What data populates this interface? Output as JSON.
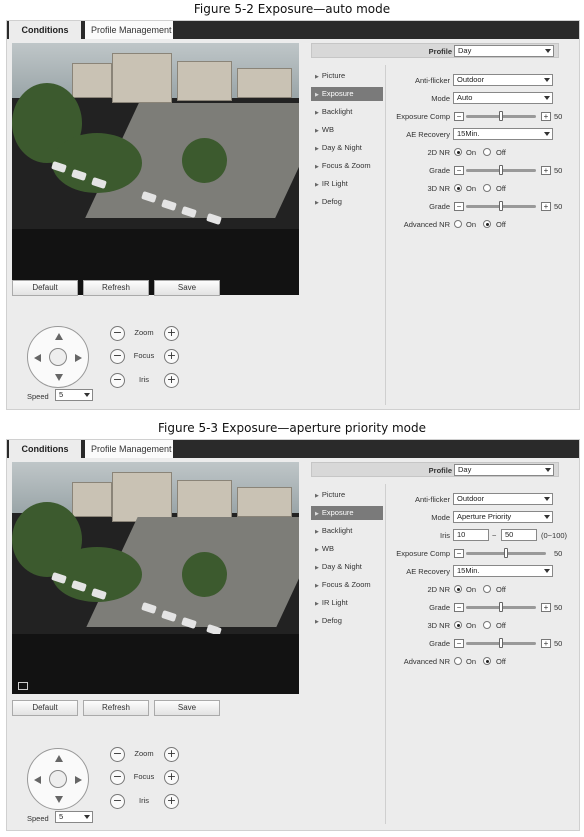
{
  "figures": [
    {
      "caption": "Figure 5-2 Exposure—auto mode",
      "tabs": [
        "Conditions",
        "Profile Management"
      ],
      "buttons": [
        "Default",
        "Refresh",
        "Save"
      ],
      "ptz": {
        "zoom": "Zoom",
        "focus": "Focus",
        "iris": "Iris",
        "speed_label": "Speed",
        "speed_value": "5",
        "minus": "−",
        "plus": "+"
      },
      "profile": {
        "label": "Profile",
        "value": "Day"
      },
      "menu": [
        "Picture",
        "Exposure",
        "Backlight",
        "WB",
        "Day & Night",
        "Focus & Zoom",
        "IR Light",
        "Defog"
      ],
      "active_menu": "Exposure",
      "fields": {
        "anti_flicker": {
          "label": "Anti-flicker",
          "value": "Outdoor"
        },
        "mode": {
          "label": "Mode",
          "value": "Auto"
        },
        "exposure_comp": {
          "label": "Exposure Comp",
          "value": "50"
        },
        "ae_recovery": {
          "label": "AE Recovery",
          "value": "15Min."
        },
        "nr2d": {
          "label": "2D NR",
          "on": "On",
          "off": "Off",
          "selected": "On"
        },
        "grade1": {
          "label": "Grade",
          "value": "50"
        },
        "nr3d": {
          "label": "3D NR",
          "on": "On",
          "off": "Off",
          "selected": "On"
        },
        "grade2": {
          "label": "Grade",
          "value": "50"
        },
        "advanced_nr": {
          "label": "Advanced NR",
          "on": "On",
          "off": "Off",
          "selected": "Off"
        }
      }
    },
    {
      "caption": "Figure 5-3 Exposure—aperture priority mode",
      "tabs": [
        "Conditions",
        "Profile Management"
      ],
      "buttons": [
        "Default",
        "Refresh",
        "Save"
      ],
      "ptz": {
        "zoom": "Zoom",
        "focus": "Focus",
        "iris": "Iris",
        "speed_label": "Speed",
        "speed_value": "5",
        "minus": "−",
        "plus": "+"
      },
      "profile": {
        "label": "Profile",
        "value": "Day"
      },
      "menu": [
        "Picture",
        "Exposure",
        "Backlight",
        "WB",
        "Day & Night",
        "Focus & Zoom",
        "IR Light",
        "Defog"
      ],
      "active_menu": "Exposure",
      "fields": {
        "anti_flicker": {
          "label": "Anti-flicker",
          "value": "Outdoor"
        },
        "mode": {
          "label": "Mode",
          "value": "Aperture Priority"
        },
        "iris": {
          "label": "Iris",
          "min": "10",
          "separator": "~",
          "max": "50",
          "range": "(0~100)"
        },
        "exposure_comp": {
          "label": "Exposure Comp",
          "value": "50"
        },
        "ae_recovery": {
          "label": "AE Recovery",
          "value": "15Min."
        },
        "nr2d": {
          "label": "2D NR",
          "on": "On",
          "off": "Off",
          "selected": "On"
        },
        "grade1": {
          "label": "Grade",
          "value": "50"
        },
        "nr3d": {
          "label": "3D NR",
          "on": "On",
          "off": "Off",
          "selected": "On"
        },
        "grade2": {
          "label": "Grade",
          "value": "50"
        },
        "advanced_nr": {
          "label": "Advanced NR",
          "on": "On",
          "off": "Off",
          "selected": "Off"
        }
      }
    }
  ]
}
